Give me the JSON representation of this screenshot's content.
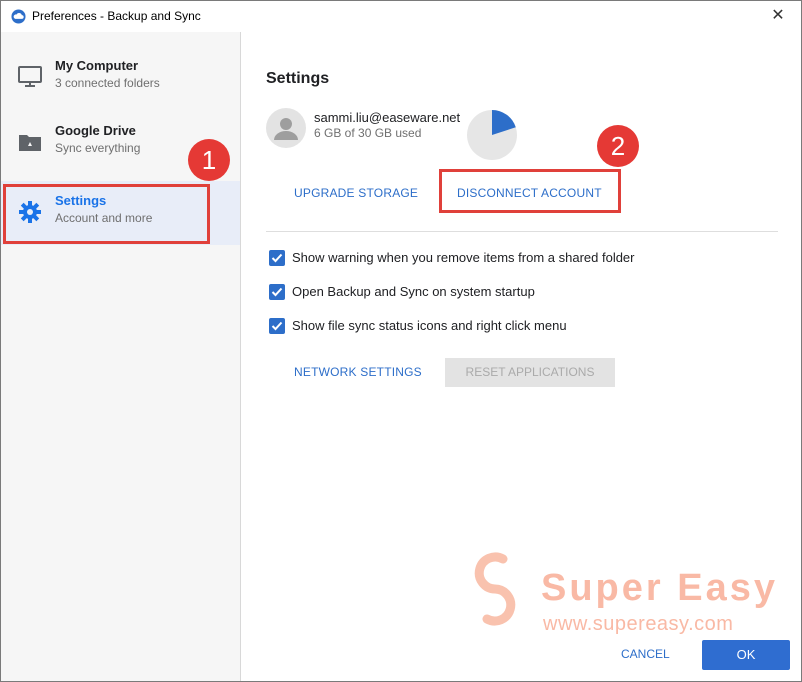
{
  "window": {
    "title": "Preferences - Backup and Sync",
    "close_glyph": "✕"
  },
  "sidebar": {
    "items": [
      {
        "title": "My Computer",
        "subtitle": "3 connected folders",
        "icon": "monitor-icon"
      },
      {
        "title": "Google Drive",
        "subtitle": "Sync everything",
        "icon": "drive-folder-icon"
      },
      {
        "title": "Settings",
        "subtitle": "Account and more",
        "icon": "gear-icon",
        "active": true
      }
    ]
  },
  "annotations": {
    "badge_1": "1",
    "badge_2": "2",
    "color": "#e53935"
  },
  "settings": {
    "title": "Settings",
    "account": {
      "email": "sammi.liu@easeware.net",
      "usage": "6 GB of 30 GB used",
      "used_fraction": 0.2
    },
    "upgrade_label": "UPGRADE STORAGE",
    "disconnect_label": "DISCONNECT ACCOUNT",
    "checkboxes": [
      {
        "label": "Show warning when you remove items from a shared folder",
        "checked": true
      },
      {
        "label": "Open Backup and Sync on system startup",
        "checked": true
      },
      {
        "label": "Show file sync status icons and right click menu",
        "checked": true
      }
    ],
    "network_label": "NETWORK SETTINGS",
    "reset_label": "RESET APPLICATIONS"
  },
  "watermark": {
    "text": "Super Easy",
    "url": "www.supereasy.com"
  },
  "footer": {
    "cancel_label": "CANCEL",
    "ok_label": "OK"
  },
  "colors": {
    "accent": "#2d6ec9",
    "ok_button": "#2f6dd0",
    "highlight": "#e0403a"
  }
}
